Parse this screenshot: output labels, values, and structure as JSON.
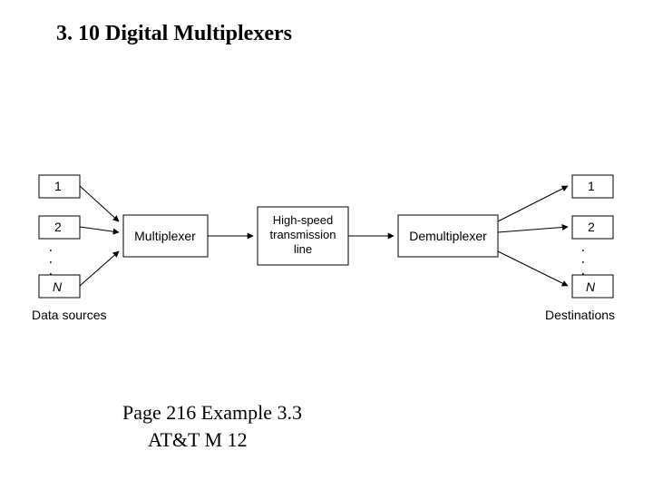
{
  "title": "3. 10 Digital Multiplexers",
  "footer": {
    "line1": "Page 216  Example 3.3",
    "line2": "AT&T M 12"
  },
  "diagram": {
    "data_sources_label": "Data sources",
    "destinations_label": "Destinations",
    "multiplexer": "Multiplexer",
    "transmission": {
      "l1": "High-speed",
      "l2": "transmission",
      "l3": "line"
    },
    "demultiplexer": "Demultiplexer",
    "left_nodes": [
      "1",
      "2",
      "N"
    ],
    "right_nodes": [
      "1",
      "2",
      "N"
    ],
    "ellipsis": ". . ."
  }
}
